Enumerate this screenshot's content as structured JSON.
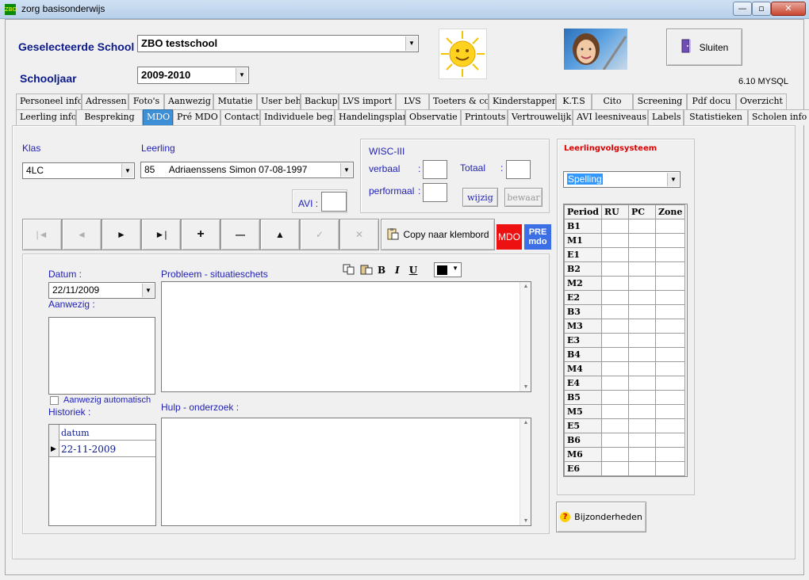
{
  "window": {
    "app_icon_text": "ZBO",
    "title": "zorg basisonderwijs",
    "minimize": "—",
    "maximize": "▫",
    "close": "✕"
  },
  "header": {
    "school_label": "Geselecteerde School :",
    "school_value": "ZBO testschool",
    "year_label": "Schooljaar",
    "year_value": "2009-2010",
    "version": "6.10 MYSQL",
    "close_button": "Sluiten"
  },
  "tabs_row1": [
    "Personeel info",
    "Adressen",
    "Foto's",
    "Aanwezig",
    "Mutatie",
    "User beh",
    "Backup",
    "LVS import",
    "LVS",
    "Toeters & co",
    "Kinderstappen",
    "K.T.S",
    "Cito",
    "Screening",
    "Pdf docu",
    "Overzicht"
  ],
  "tabs_row2": [
    "Leerling info",
    "Bespreking",
    "MDO",
    "Pré MDO",
    "Contact",
    "Individuele beg.",
    "Handelingsplan",
    "Observatie",
    "Printouts",
    "Vertrouwelijk",
    "AVI leesniveaus",
    "Labels",
    "Statistieken",
    "Scholen info"
  ],
  "active_tab": "MDO",
  "student": {
    "klas_label": "Klas",
    "klas_value": "4LC",
    "leerling_label": "Leerling",
    "leerling_nr": "85",
    "leerling_name": "Adriaenssens Simon 07-08-1997",
    "avi_label": "AVI :"
  },
  "wisc": {
    "title": "WISC-III",
    "verbaal": "verbaal",
    "performaal": "performaal",
    "totaal": "Totaal",
    "colon": ":",
    "wijzig": "wijzig",
    "bewaar": "bewaar"
  },
  "toolbar": {
    "first": "|◄",
    "prev": "◄",
    "next": "►",
    "last": "►|",
    "add": "+",
    "delete": "—",
    "up": "▲",
    "confirm": "✓",
    "cancel": "✕",
    "copy": "Copy naar klembord",
    "mdo": "MDO",
    "pre": "PRE",
    "pre_sub": "mdo"
  },
  "form": {
    "datum_label": "Datum :",
    "datum_value": "22/11/2009",
    "aanwezig_label": "Aanwezig :",
    "auto_label": "Aanwezig automatisch",
    "historiek_label": "Historiek :",
    "hist_col": "datum",
    "hist_rows": [
      "22-11-2009"
    ],
    "probleem_label": "Probleem - situatieschets",
    "hulp_label": "Hulp - onderzoek :",
    "bold": "B",
    "italic": "I",
    "underline": "U"
  },
  "lvs": {
    "title": "Leerlingvolgsysteem",
    "select": "Spelling",
    "columns": [
      "Period",
      "RU",
      "PC",
      "Zone"
    ],
    "periods": [
      "B1",
      "M1",
      "E1",
      "B2",
      "M2",
      "E2",
      "B3",
      "M3",
      "E3",
      "B4",
      "M4",
      "E4",
      "B5",
      "M5",
      "E5",
      "B6",
      "M6",
      "E6"
    ],
    "bijzonderheden": "Bijzonderheden"
  },
  "colors": {
    "active_tab": "#3d8fd6",
    "mdo_button": "#ee1111",
    "pre_button": "#3c6ee6",
    "lvs_title": "#dd0000",
    "label_navy": "#0c1a8a"
  }
}
